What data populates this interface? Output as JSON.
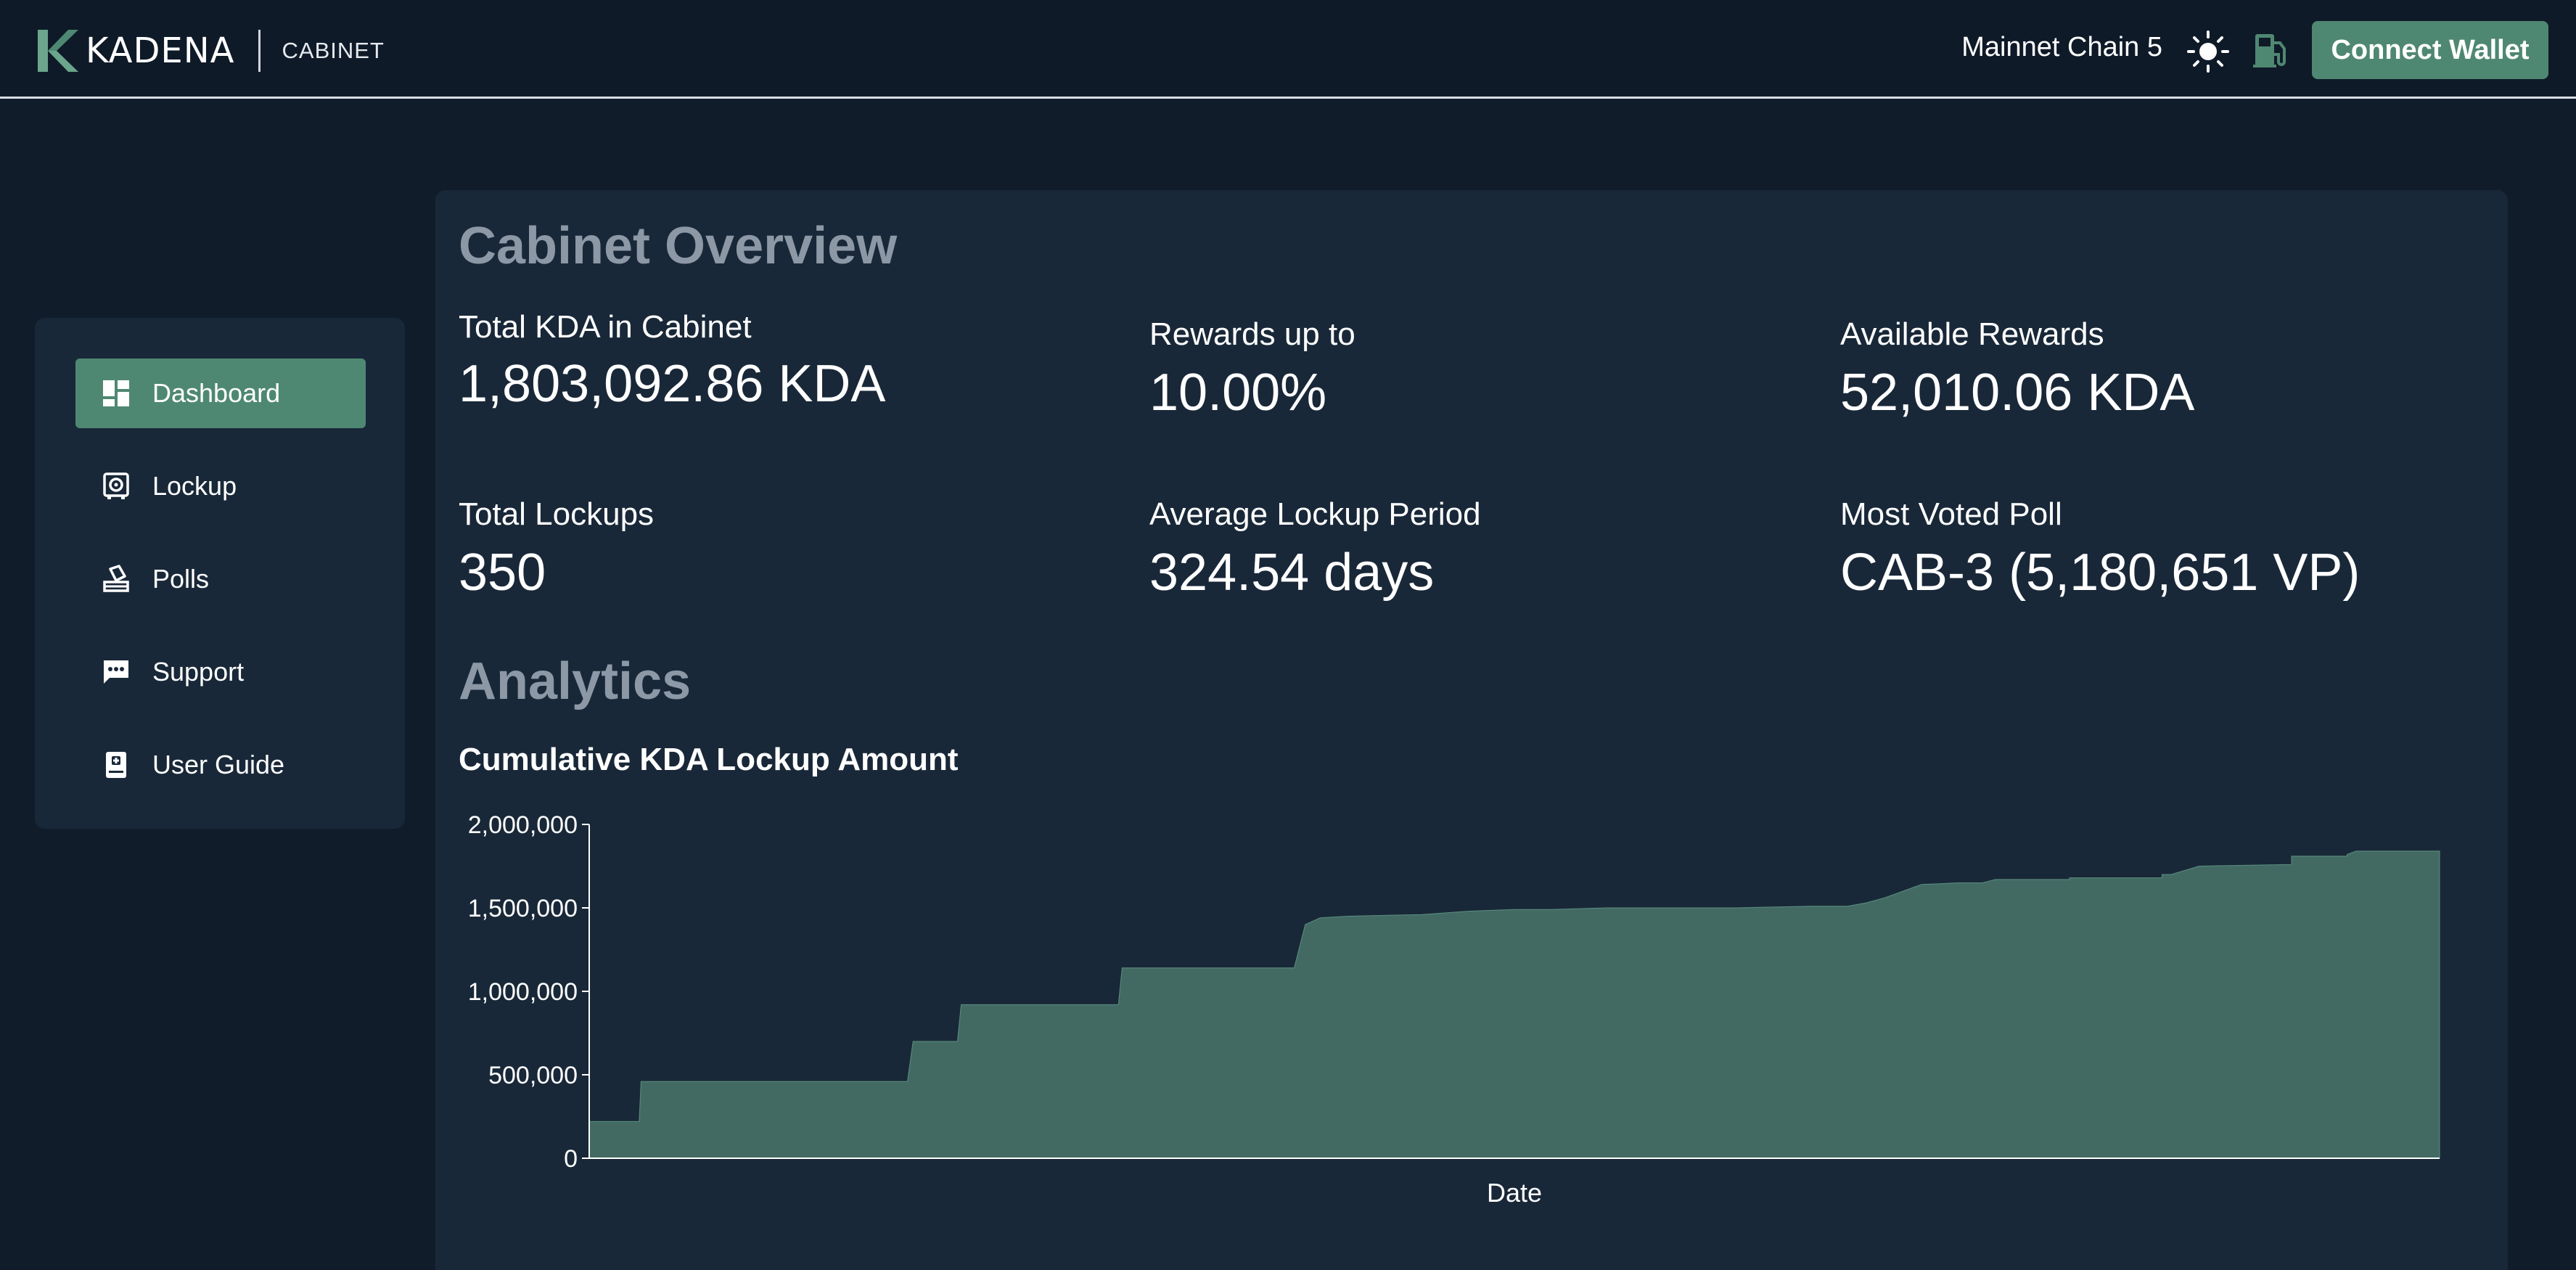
{
  "header": {
    "brand": "KADENA",
    "product": "CABINET",
    "chain": "Mainnet Chain 5",
    "theme_icon": "sun-icon",
    "gas_icon": "gas-pump-icon",
    "connect_label": "Connect Wallet",
    "accent_color": "#4f8872"
  },
  "sidebar": {
    "items": [
      {
        "label": "Dashboard",
        "icon": "dashboard-icon",
        "active": true
      },
      {
        "label": "Lockup",
        "icon": "vault-icon",
        "active": false
      },
      {
        "label": "Polls",
        "icon": "ballot-icon",
        "active": false
      },
      {
        "label": "Support",
        "icon": "chat-icon",
        "active": false
      },
      {
        "label": "User Guide",
        "icon": "book-icon",
        "active": false
      }
    ]
  },
  "overview": {
    "title": "Cabinet Overview",
    "stats": [
      {
        "label": "Total KDA in Cabinet",
        "value": "1,803,092.86 KDA"
      },
      {
        "label": "Rewards up to",
        "value": "10.00%"
      },
      {
        "label": "Available Rewards",
        "value": "52,010.06 KDA"
      },
      {
        "label": "Total Lockups",
        "value": "350"
      },
      {
        "label": "Average Lockup Period",
        "value": "324.54 days"
      },
      {
        "label": "Most Voted Poll",
        "value": "CAB-3 (5,180,651 VP)"
      }
    ]
  },
  "analytics": {
    "title": "Analytics"
  },
  "chart_data": {
    "type": "area",
    "title": "Cumulative KDA Lockup Amount",
    "xlabel": "Date",
    "ylabel": "",
    "ylim": [
      0,
      2000000
    ],
    "yticks": [
      "2,000,000",
      "1,500,000",
      "1,000,000",
      "500,000",
      "0"
    ],
    "grid": false,
    "color": "#426a63",
    "x": [
      0,
      0.027,
      0.028,
      0.172,
      0.175,
      0.199,
      0.201,
      0.286,
      0.288,
      0.381,
      0.387,
      0.395,
      0.41,
      0.45,
      0.475,
      0.5,
      0.52,
      0.55,
      0.6,
      0.62,
      0.66,
      0.68,
      0.69,
      0.7,
      0.72,
      0.74,
      0.753,
      0.76,
      0.8,
      0.8,
      0.85,
      0.85,
      0.855,
      0.87,
      0.87,
      0.92,
      0.92,
      0.95,
      0.95,
      0.955,
      1.0
    ],
    "y": [
      220000,
      220000,
      460000,
      460000,
      700000,
      700000,
      920000,
      920000,
      1140000,
      1140000,
      1400000,
      1440000,
      1450000,
      1460000,
      1480000,
      1490000,
      1490000,
      1500000,
      1500000,
      1500000,
      1510000,
      1510000,
      1530000,
      1560000,
      1640000,
      1650000,
      1650000,
      1670000,
      1670000,
      1680000,
      1680000,
      1700000,
      1700000,
      1750000,
      1750000,
      1760000,
      1810000,
      1810000,
      1820000,
      1840000,
      1840000
    ]
  }
}
